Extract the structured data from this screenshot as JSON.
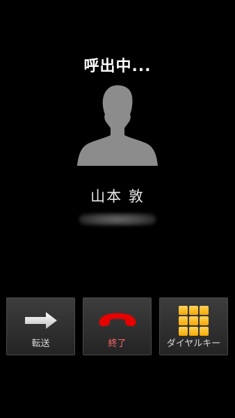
{
  "call": {
    "status": "呼出中...",
    "caller_name": "山本 敦"
  },
  "actions": {
    "transfer_label": "転送",
    "end_label": "終了",
    "dialpad_label": "ダイヤルキー"
  },
  "icons": {
    "avatar": "person-silhouette-icon",
    "transfer": "arrow-right-icon",
    "end": "phone-hangup-icon",
    "dialpad": "dialpad-grid-icon"
  },
  "colors": {
    "background": "#000000",
    "end_call_red": "#ee0000",
    "end_label_red": "#ff6666",
    "dialpad_orange": "#f6a800"
  }
}
